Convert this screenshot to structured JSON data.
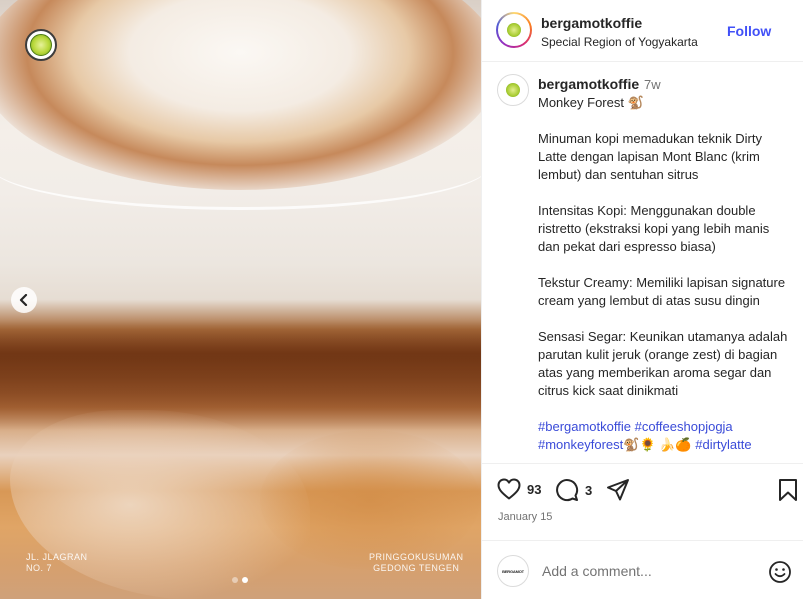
{
  "media": {
    "caption_left": "JL. JLAGRAN\nNO. 7",
    "caption_right": "PRINGGOKUSUMAN\nGEDONG TENGEN",
    "slide_index": 2,
    "slide_count": 2
  },
  "header": {
    "username": "bergamotkoffie",
    "location": "Special Region of Yogyakarta",
    "follow_label": "Follow"
  },
  "post": {
    "username": "bergamotkoffie",
    "time": "7w",
    "title": "Monkey Forest 🐒",
    "paragraphs": [
      "Minuman kopi memadukan teknik Dirty Latte dengan lapisan Mont Blanc (krim lembut) dan sentuhan sitrus",
      "Intensitas Kopi: Menggunakan double ristretto (ekstraksi kopi yang lebih manis dan pekat dari espresso biasa)",
      "Tekstur Creamy: Memiliki lapisan signature cream yang lembut di atas susu dingin",
      "Sensasi Segar: Keunikan utamanya adalah parutan kulit jeruk (orange zest) di bagian atas yang memberikan aroma segar dan citrus kick saat dinikmati"
    ],
    "hashtags": "#bergamotkoffie #coffeeshopjogja #monkeyforest🐒🌻 🍌🍊 #dirtylatte"
  },
  "actions": {
    "likes": "93",
    "comments": "3",
    "date": "January 15"
  },
  "comment_bar": {
    "placeholder": "Add a comment...",
    "avatar_text": "BERGAMOT"
  },
  "colors": {
    "follow": "#4150f7",
    "hashtag": "#3a4bd8",
    "muted": "#737373"
  }
}
